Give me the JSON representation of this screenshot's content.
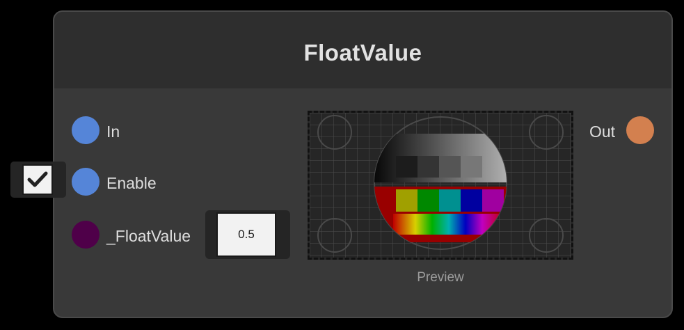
{
  "node": {
    "title": "FloatValue",
    "inputs": [
      {
        "label": "In",
        "color": "#5585d8"
      },
      {
        "label": "Enable",
        "color": "#5585d8"
      },
      {
        "label": "_FloatValue",
        "color": "#4f0049"
      }
    ],
    "enable_checked": true,
    "float_value": "0.5",
    "outputs": [
      {
        "label": "Out",
        "color": "#d3804f"
      }
    ],
    "preview_label": "Preview"
  }
}
